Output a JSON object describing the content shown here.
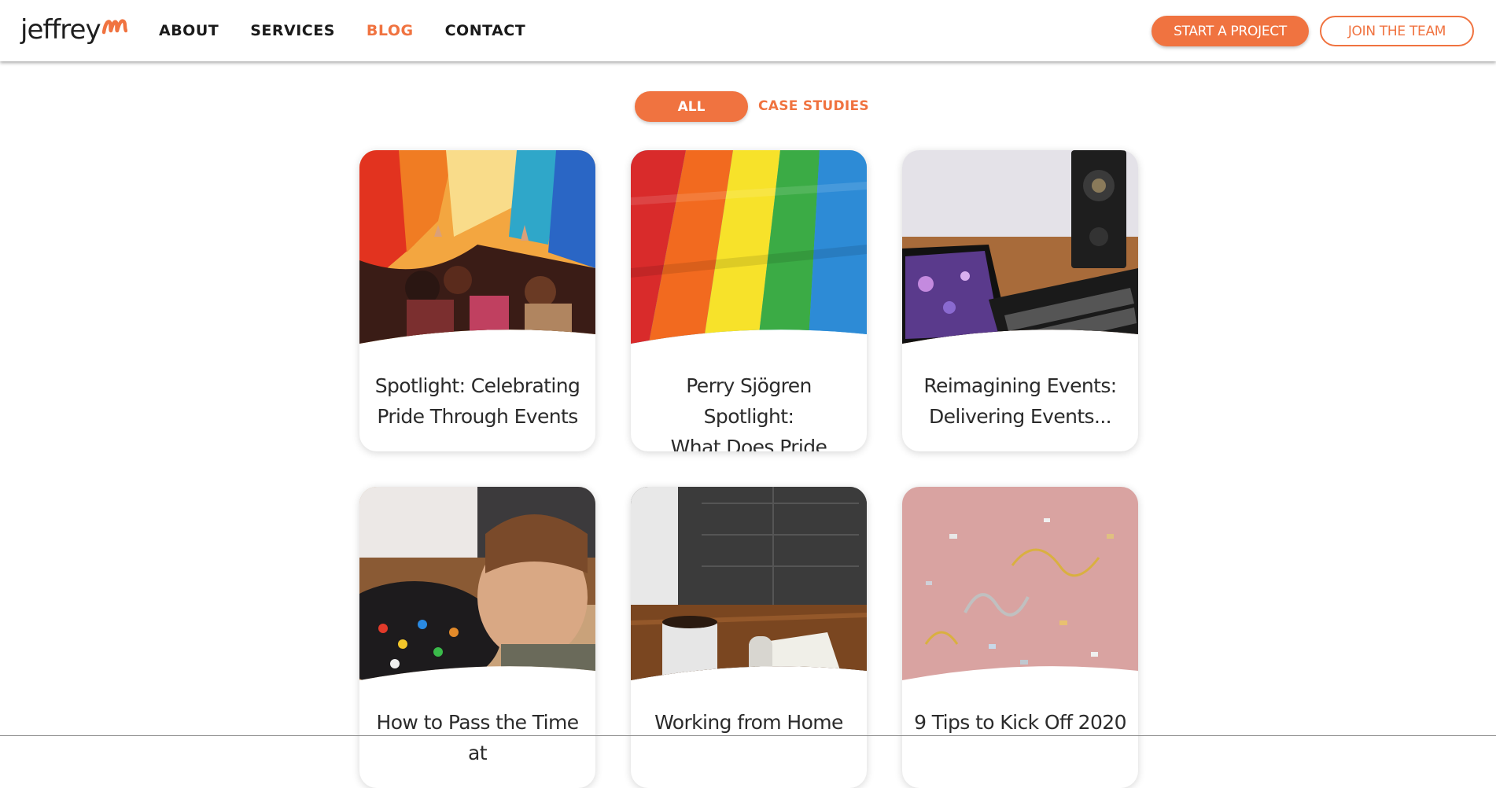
{
  "brand": {
    "logo_text": "jeffrey",
    "logo_mark_icon": "m-swoosh-icon",
    "accent_color": "#f07340"
  },
  "nav": {
    "items": [
      {
        "label": "ABOUT",
        "active": false
      },
      {
        "label": "SERVICES",
        "active": false
      },
      {
        "label": "BLOG",
        "active": true
      },
      {
        "label": "CONTACT",
        "active": false
      }
    ]
  },
  "header_actions": {
    "start_project": "START A PROJECT",
    "join_team": "JOIN THE TEAM"
  },
  "filters": {
    "all": "ALL",
    "case_studies": "CASE STUDIES",
    "selected": "ALL"
  },
  "posts": [
    {
      "title_line1": "Spotlight: Celebrating",
      "title_line2": "Pride Through Events",
      "image": "pride-crowd-photo"
    },
    {
      "title_line1": "Perry Sjögren Spotlight:",
      "title_line2": "What Does Pride Mea...",
      "image": "rainbow-flag-photo"
    },
    {
      "title_line1": "Reimagining Events:",
      "title_line2": "Delivering Events...",
      "image": "tablet-keyboard-photo"
    },
    {
      "title_line1": "How to Pass the Time at",
      "title_line2": "",
      "image": "child-lego-photo"
    },
    {
      "title_line1": "Working from Home",
      "title_line2": "",
      "image": "coffee-desk-photo"
    },
    {
      "title_line1": "9 Tips to Kick Off 2020",
      "title_line2": "",
      "image": "confetti-photo"
    }
  ]
}
